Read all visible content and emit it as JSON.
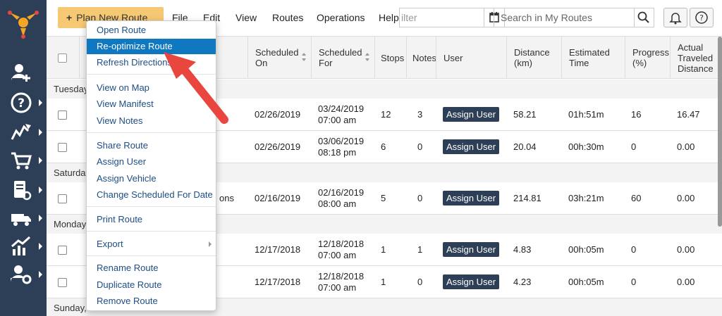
{
  "topbar": {
    "plan_button": "Plan New Route",
    "menus": [
      "File",
      "Edit",
      "View",
      "Routes",
      "Operations",
      "Help"
    ],
    "filter_placeholder": "ilter",
    "search_placeholder": "Search in My Routes"
  },
  "sidebar": {
    "icons": [
      "logo-icon",
      "add-user-icon",
      "help-circle-icon",
      "routes-icon",
      "cart-icon",
      "reports-icon",
      "fleet-icon",
      "analytics-icon",
      "settings-user-icon"
    ]
  },
  "table": {
    "headers": {
      "scheduled_on": "Scheduled On",
      "scheduled_for": "Scheduled For",
      "stops": "Stops",
      "notes": "Notes",
      "user": "User",
      "distance": "Distance (km)",
      "estimated_time": "Estimated Time",
      "progress": "Progress (%)",
      "actual_distance": "Actual Traveled Distance"
    },
    "groups": [
      {
        "label": "Tuesday"
      },
      {
        "label": "Saturday"
      },
      {
        "label": "Monday"
      },
      {
        "label": "Sunday, ..."
      }
    ],
    "assign_label": "Assign User",
    "rows": [
      {
        "name_fragment": "",
        "scheduled_on": "02/26/2019",
        "scheduled_for_date": "03/24/2019",
        "scheduled_for_time": "07:00 am",
        "stops": "12",
        "notes": "3",
        "distance": "58.21",
        "est_time": "01h:51m",
        "progress": "16",
        "actual": "16.47"
      },
      {
        "name_fragment": "",
        "scheduled_on": "02/26/2019",
        "scheduled_for_date": "03/06/2019",
        "scheduled_for_time": "08:18 pm",
        "stops": "6",
        "notes": "0",
        "distance": "20.04",
        "est_time": "00h:30m",
        "progress": "0",
        "actual": "0.00"
      },
      {
        "name_fragment": "ons",
        "scheduled_on": "02/16/2019",
        "scheduled_for_date": "02/16/2019",
        "scheduled_for_time": "08:00 am",
        "stops": "5",
        "notes": "0",
        "distance": "214.81",
        "est_time": "03h:21m",
        "progress": "60",
        "actual": "0.00"
      },
      {
        "name_fragment": "",
        "scheduled_on": "12/17/2018",
        "scheduled_for_date": "12/18/2018",
        "scheduled_for_time": "07:00 am",
        "stops": "1",
        "notes": "1",
        "distance": "4.83",
        "est_time": "00h:05m",
        "progress": "0",
        "actual": "0.00"
      },
      {
        "name_fragment": "",
        "scheduled_on": "12/17/2018",
        "scheduled_for_date": "12/18/2018",
        "scheduled_for_time": "07:00 am",
        "stops": "1",
        "notes": "0",
        "distance": "4.23",
        "est_time": "00h:05m",
        "progress": "0",
        "actual": "0.00"
      }
    ]
  },
  "context_menu": {
    "items": [
      "Open Route",
      "Re-optimize Route",
      "Refresh Directions",
      "View on Map",
      "View Manifest",
      "View Notes",
      "Share Route",
      "Assign User",
      "Assign Vehicle",
      "Change Scheduled For Date",
      "Print Route",
      "Export",
      "Rename Route",
      "Duplicate Route",
      "Remove Route"
    ],
    "active_item": "Re-optimize Route",
    "highlight_color": "#0f78c0"
  },
  "annotation": {
    "arrow_color": "#e8463e"
  },
  "colors": {
    "sidebar": "#2d3e57",
    "plan_button": "#f7c873",
    "link": "#1d4e85"
  }
}
